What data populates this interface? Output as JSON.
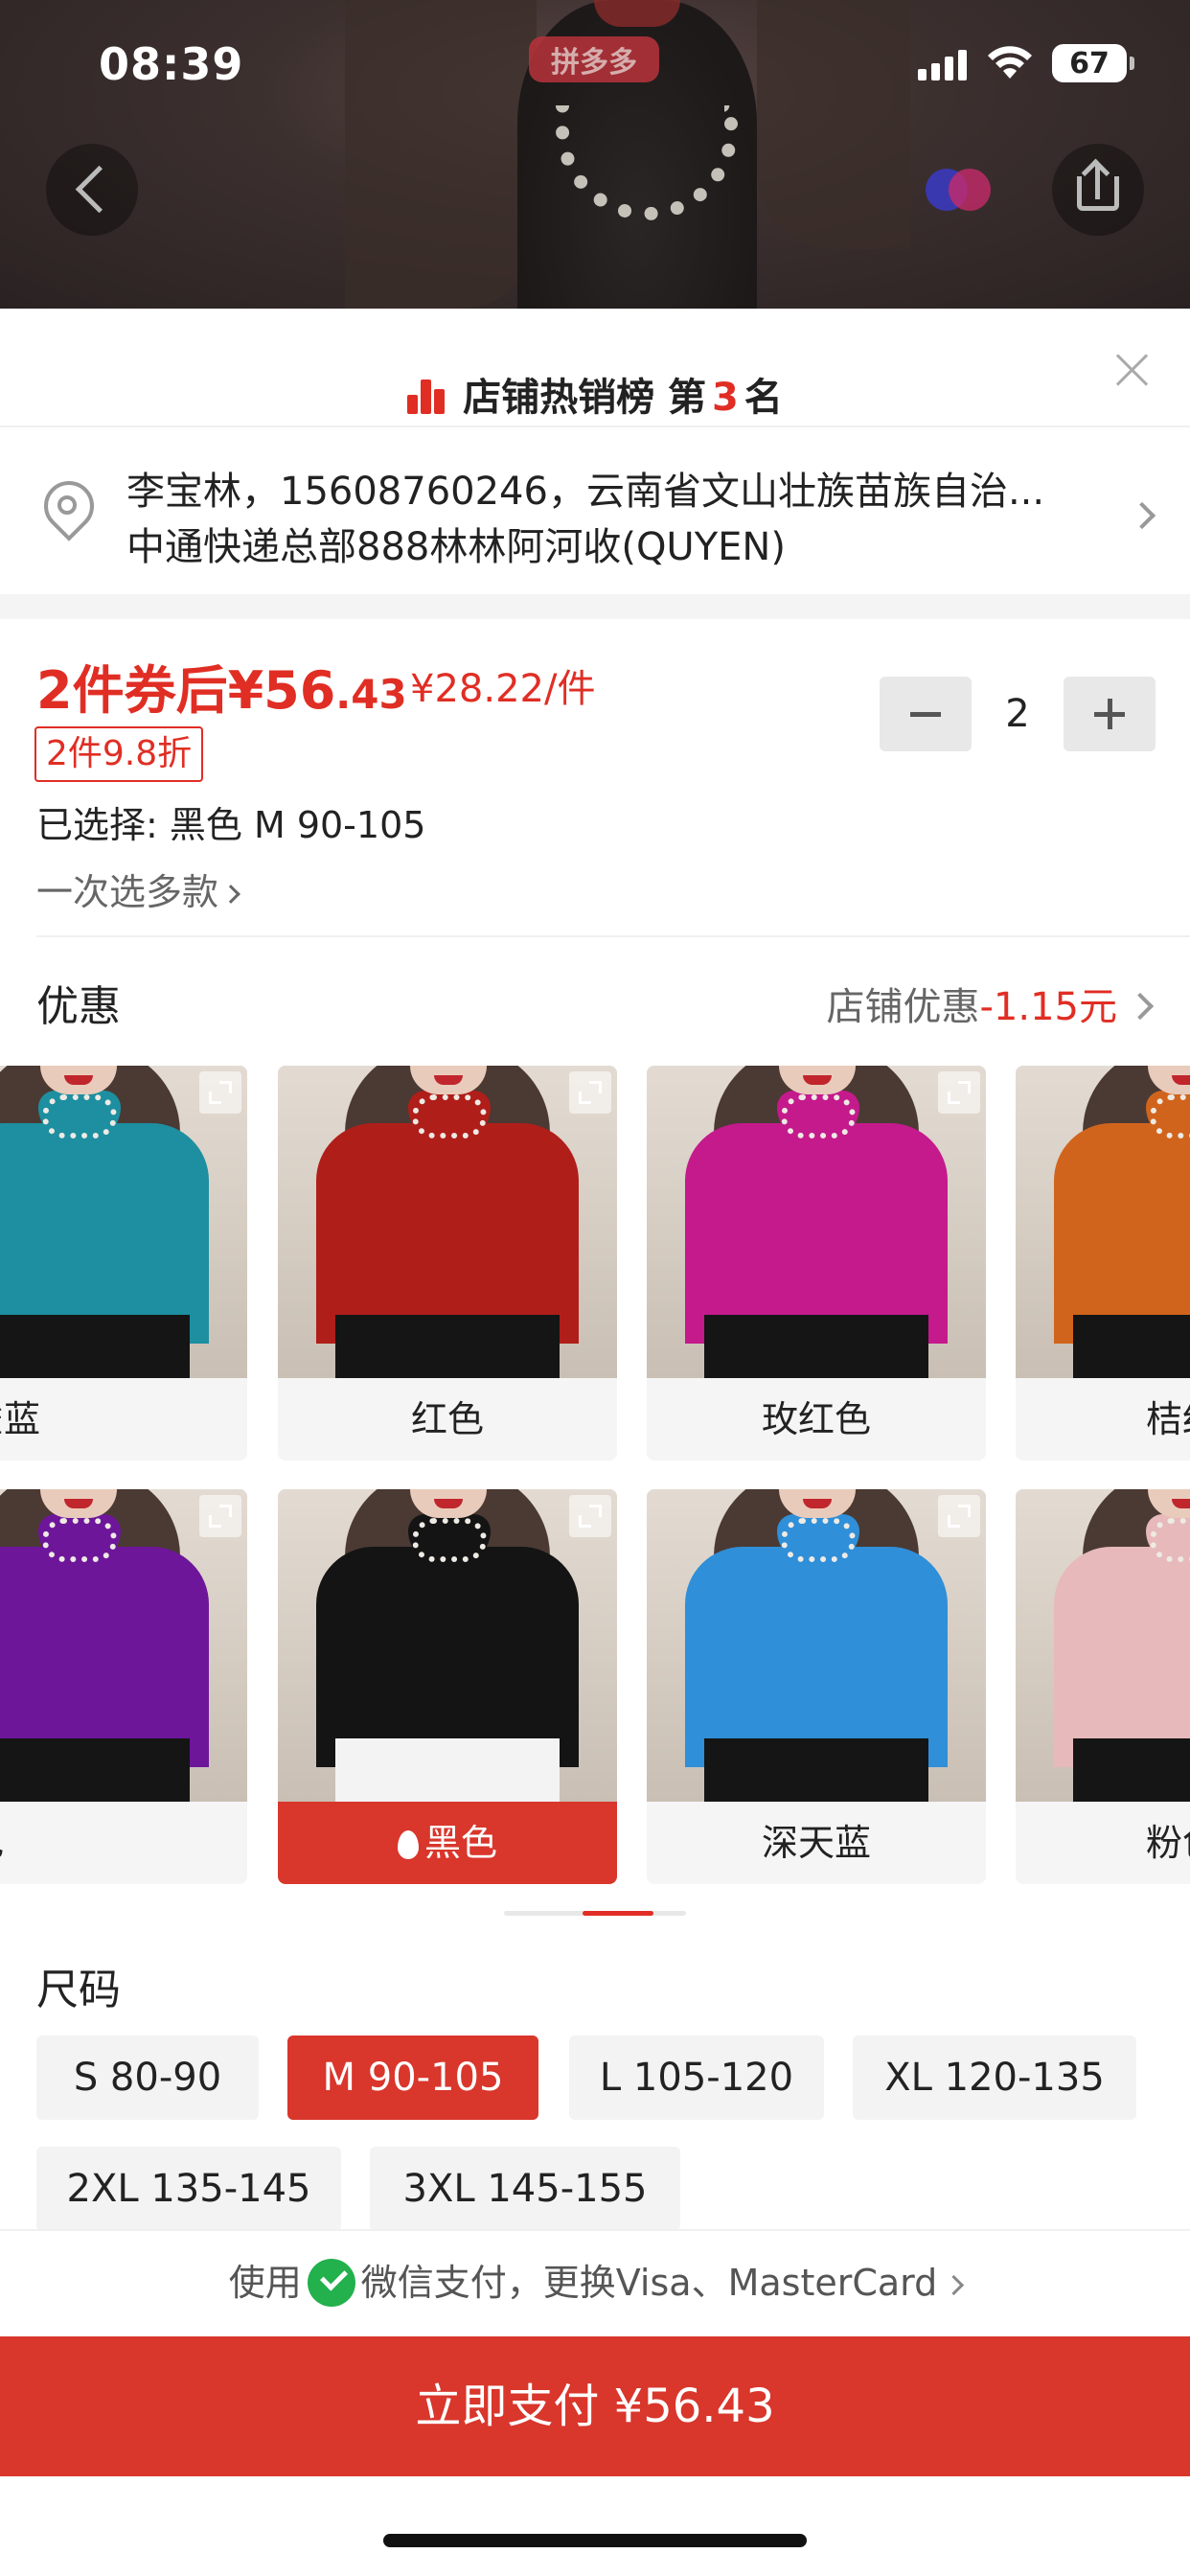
{
  "status_bar": {
    "time": "08:39",
    "battery": "67"
  },
  "top": {
    "logo_text": "拼多多"
  },
  "rank": {
    "prefix": "店铺热销榜 第",
    "number": "3",
    "suffix": "名"
  },
  "address": {
    "line1": "李宝林，15608760246，云南省文山壮族苗族自治...",
    "line2": "中通快递总部888林林阿河收(QUYEN)"
  },
  "price": {
    "main_prefix": "2件券后¥56",
    "main_decimal": ".43",
    "unit_price": "¥28.22/件",
    "discount_tag": "2件9.8折",
    "quantity": "2",
    "selected": "已选择: 黑色 M 90-105",
    "multi_select": "一次选多款"
  },
  "promo": {
    "title": "优惠",
    "label": "店铺优惠",
    "value": "-1.15元"
  },
  "colors": {
    "row1": [
      "孔雀蓝",
      "红色",
      "玫红色",
      "桔红"
    ],
    "row2": [
      "紫色",
      "黑色",
      "深天蓝",
      "粉色"
    ],
    "selected": "黑色",
    "swatch_hex": {
      "孔雀蓝": "#1d8fa0",
      "红色": "#b01e1a",
      "玫红色": "#c41a8c",
      "桔红": "#d1641c",
      "紫色": "#6d169a",
      "黑色": "#141414",
      "深天蓝": "#2f8fd8",
      "粉色": "#e7b9bb"
    }
  },
  "sizes": {
    "title": "尺码",
    "options": [
      "S 80-90",
      "M 90-105",
      "L 105-120",
      "XL 120-135",
      "2XL 135-145",
      "3XL 145-155"
    ],
    "selected": "M 90-105"
  },
  "payment": {
    "prefix": "使用",
    "method": "微信支付，更换Visa、MasterCard"
  },
  "buy_button": "立即支付 ¥56.43",
  "theme": {
    "accent": "#e02e24",
    "wechat": "#22b14c"
  }
}
